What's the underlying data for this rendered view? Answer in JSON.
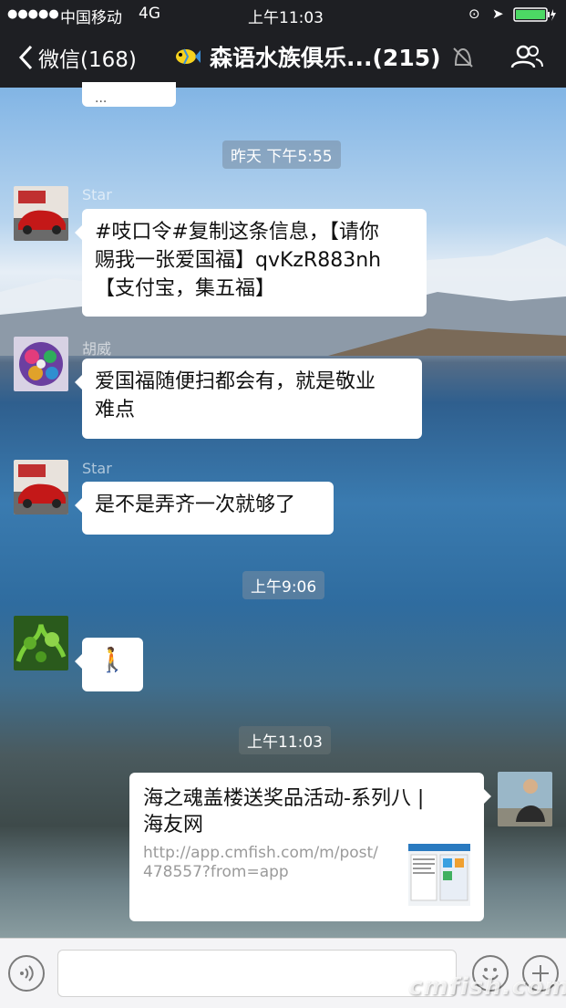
{
  "status_bar": {
    "signal": "●●●●●",
    "carrier": "中国移动",
    "network": "4G",
    "time": "上午11:03"
  },
  "nav": {
    "back_label": "微信(168)",
    "chat_title": "森语水族俱乐...(215)"
  },
  "messages": {
    "top_fragment": "...",
    "ts1": "昨天 下午5:55",
    "m1": {
      "sender": "Star",
      "lines": [
        "#吱口令#复制这条信息，【请你",
        "赐我一张爱国福】qvKzR883nh",
        "【支付宝，集五福】"
      ]
    },
    "m2": {
      "sender": "胡威",
      "lines": [
        "爱国福随便扫都会有，就是敬业",
        "难点"
      ]
    },
    "m3": {
      "sender": "Star",
      "text": "是不是弄齐一次就够了"
    },
    "ts2": "上午9:06",
    "m4": {
      "sender": "",
      "emoji": "🚶"
    },
    "ts3": "上午11:03",
    "link": {
      "title_lines": [
        "海之魂盖楼送奖品活动-系列八 |",
        "海友网"
      ],
      "url_lines": [
        "http://app.cmfish.com/m/post/",
        "478557?from=app"
      ]
    }
  },
  "watermark": "cmfish.com",
  "colors": {
    "nav_bg": "#1e1f23",
    "bubble": "#ffffff",
    "battery": "#4cd964"
  }
}
